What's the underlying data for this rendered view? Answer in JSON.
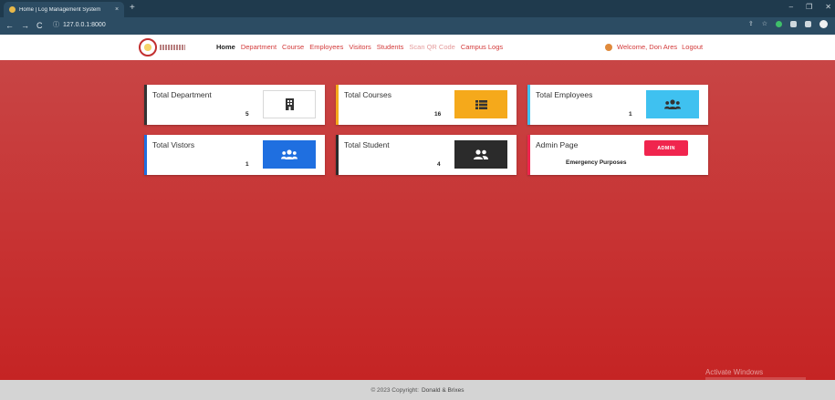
{
  "browser": {
    "tab_title": "Home | Log Management System",
    "tab_close": "×",
    "new_tab": "+",
    "url": "127.0.0.1:8000",
    "back": "←",
    "forward": "→",
    "reload": "C",
    "info_icon": "ⓘ",
    "win_minimize": "–",
    "win_maximize": "❐",
    "win_close": "✕"
  },
  "header": {
    "nav": [
      {
        "label": "Home",
        "state": "active"
      },
      {
        "label": "Department",
        "state": "normal"
      },
      {
        "label": "Course",
        "state": "normal"
      },
      {
        "label": "Employees",
        "state": "normal"
      },
      {
        "label": "Visitors",
        "state": "normal"
      },
      {
        "label": "Students",
        "state": "normal"
      },
      {
        "label": "Scan QR Code",
        "state": "muted"
      },
      {
        "label": "Campus Logs",
        "state": "normal"
      }
    ],
    "welcome": "Welcome, Don Ares",
    "logout": "Logout"
  },
  "cards": {
    "department": {
      "title": "Total Department",
      "count": "5",
      "icon": "building-icon",
      "color": "#ffffff"
    },
    "courses": {
      "title": "Total Courses",
      "count": "16",
      "icon": "list-icon",
      "color": "#f5a91b"
    },
    "employees": {
      "title": "Total Employees",
      "count": "1",
      "icon": "users-icon",
      "color": "#3fc1f0"
    },
    "visitors": {
      "title": "Total Vistors",
      "count": "1",
      "icon": "users-icon",
      "color": "#1f6fe0"
    },
    "students": {
      "title": "Total Student",
      "count": "4",
      "icon": "user-group-icon",
      "color": "#2b2b2b"
    },
    "admin": {
      "title": "Admin Page",
      "button": "ADMIN",
      "subtitle": "Emergency Purposes",
      "color": "#f0254e"
    }
  },
  "watermark": "Activate Windows",
  "footer": {
    "copyright": "© 2023 Copyright:",
    "authors": "Donald & Brixes"
  }
}
